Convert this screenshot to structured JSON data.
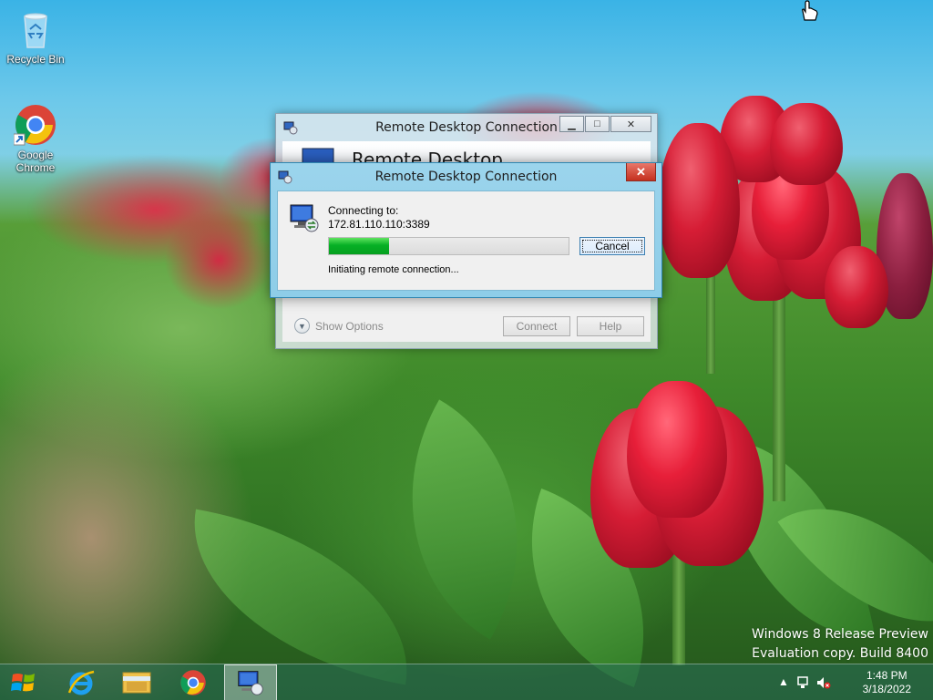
{
  "desktop": {
    "icons": [
      {
        "label": "Recycle Bin"
      },
      {
        "label": "Google Chrome"
      }
    ],
    "watermark": {
      "line1": "Windows 8 Release Preview",
      "line2": "Evaluation copy. Build 8400"
    }
  },
  "back_window": {
    "title": "Remote Desktop Connection",
    "banner_text": "Remote Desktop",
    "show_options": "Show Options",
    "connect_label": "Connect",
    "help_label": "Help"
  },
  "dialog": {
    "title": "Remote Desktop Connection",
    "connecting_label": "Connecting to:",
    "address": "172.81.110.110:3389",
    "progress_fraction": 0.25,
    "cancel_label": "Cancel",
    "status": "Initiating remote connection..."
  },
  "taskbar": {
    "apps": [
      {
        "name": "internet-explorer"
      },
      {
        "name": "file-explorer"
      },
      {
        "name": "google-chrome"
      },
      {
        "name": "remote-desktop",
        "active": true
      }
    ],
    "time": "1:48 PM",
    "date": "3/18/2022"
  },
  "colors": {
    "progress_green": "#06b025",
    "close_red": "#c4301f",
    "sky": "#3ab3e6"
  }
}
